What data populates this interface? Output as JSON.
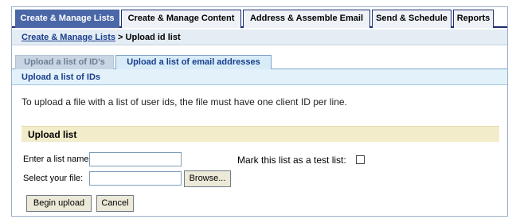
{
  "tabs": [
    {
      "label": "Create & Manage Lists"
    },
    {
      "label": "Create & Manage Content"
    },
    {
      "label": "Address & Assemble Email"
    },
    {
      "label": "Send & Schedule"
    },
    {
      "label": "Reports"
    }
  ],
  "breadcrumb": {
    "link": "Create & Manage Lists",
    "separator": ">",
    "current": "Upload id list"
  },
  "subtabs": [
    {
      "label": "Upload a list of ID's"
    },
    {
      "label": "Upload a list of email addresses"
    }
  ],
  "section": {
    "title": "Upload a list of IDs",
    "description": "To upload a file with a list of user ids, the file must have one client ID per line."
  },
  "form": {
    "heading": "Upload list",
    "name_label": "Enter a list name:",
    "name_value": "",
    "file_label": "Select your file:",
    "file_value": "",
    "browse_label": "Browse...",
    "test_label": "Mark this list as a test list:",
    "test_checked": false,
    "begin_label": "Begin upload",
    "cancel_label": "Cancel"
  },
  "colors": {
    "active_tab": "#4a67a7",
    "tab_border": "#1c2d6e",
    "link": "#1a3e8c",
    "panel_head": "#f3eccb"
  }
}
